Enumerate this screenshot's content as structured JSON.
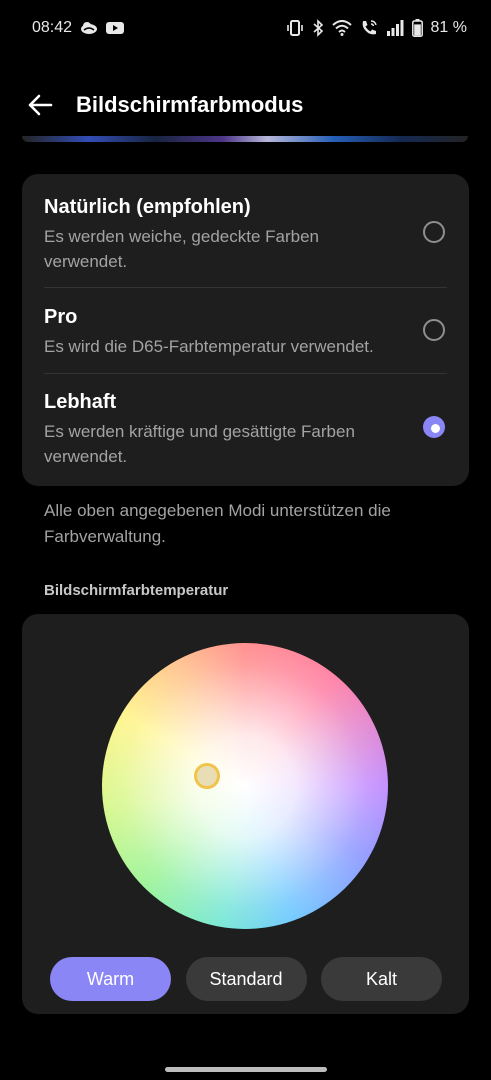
{
  "status_bar": {
    "time": "08:42",
    "battery_percent": "81 %",
    "battery_level": 0.81,
    "left_icons": [
      "cloud-icon",
      "youtube-icon"
    ],
    "right_icons": [
      "vibrate-icon",
      "bluetooth-icon",
      "wifi-icon",
      "wifi-call-icon",
      "signal-icon",
      "battery-icon"
    ]
  },
  "header": {
    "title": "Bildschirmfarbmodus",
    "back_icon": "arrow-left-icon"
  },
  "modes": [
    {
      "title": "Natürlich (empfohlen)",
      "description": "Es werden weiche, gedeckte Farben verwendet.",
      "selected": false
    },
    {
      "title": "Pro",
      "description": "Es wird die D65-Farbtemperatur verwendet.",
      "selected": false
    },
    {
      "title": "Lebhaft",
      "description": "Es werden kräftige und gesättigte Farben verwendet.",
      "selected": true
    }
  ],
  "note": "Alle oben angegebenen Modi unterstützen die Farbverwaltung.",
  "temperature": {
    "section_title": "Bildschirmfarbtemperatur",
    "presets": [
      {
        "label": "Warm",
        "active": true
      },
      {
        "label": "Standard",
        "active": false
      },
      {
        "label": "Kalt",
        "active": false
      }
    ]
  },
  "colors": {
    "accent": "#8a86f5",
    "card": "#1e1e1e",
    "background": "#000000",
    "secondary_text": "#a3a3a3",
    "handle_ring": "#f0c34a"
  }
}
